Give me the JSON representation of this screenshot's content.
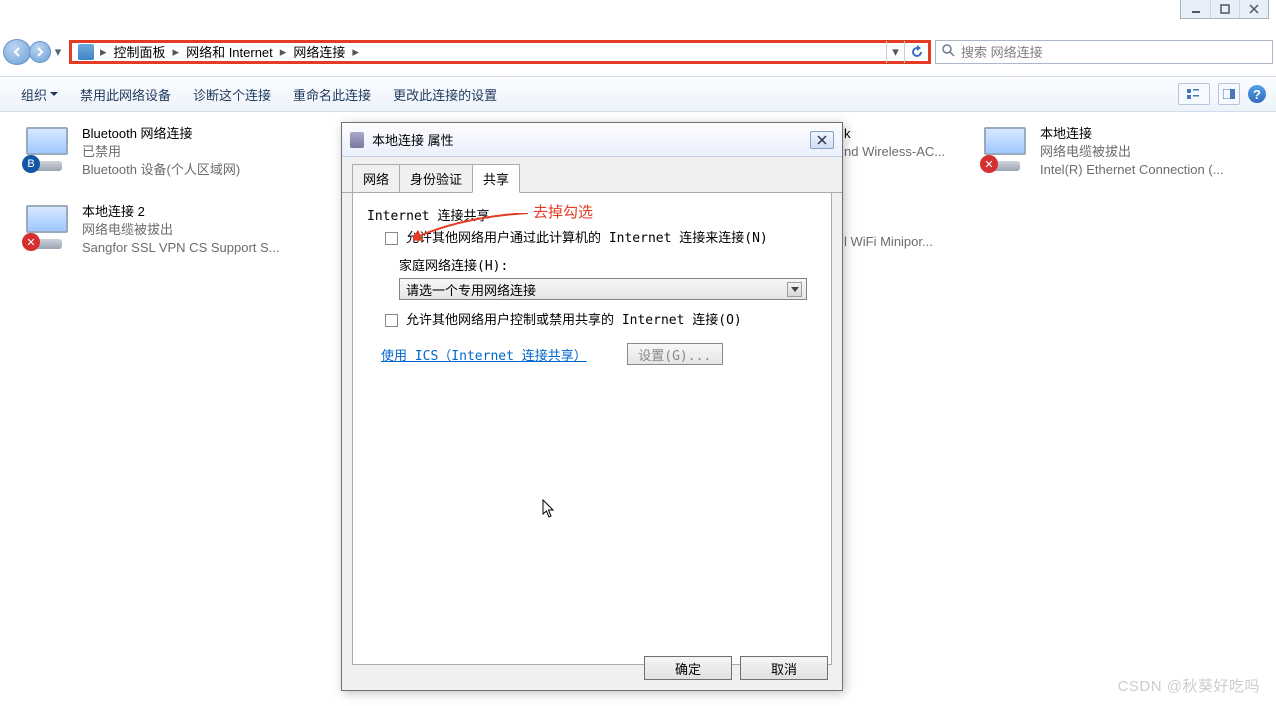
{
  "window_controls": [
    "minimize",
    "maximize",
    "close"
  ],
  "breadcrumb": {
    "items": [
      "控制面板",
      "网络和 Internet",
      "网络连接"
    ]
  },
  "search": {
    "placeholder": "搜索 网络连接"
  },
  "commandbar": {
    "organize": "组织",
    "disable": "禁用此网络设备",
    "diagnose": "诊断这个连接",
    "rename": "重命名此连接",
    "settings": "更改此连接的设置"
  },
  "connections": [
    {
      "title": "Bluetooth 网络连接",
      "status": "已禁用",
      "device": "Bluetooth 设备(个人区域网)",
      "badge": "bt"
    },
    {
      "title": "本地连接 2",
      "status": "网络电缆被拔出",
      "device": "Sangfor SSL VPN CS Support S...",
      "badge": "x"
    },
    {
      "title": "k",
      "status": "",
      "device": "nd Wireless-AC...",
      "badge": ""
    },
    {
      "title": "",
      "status": "",
      "device": "l WiFi Minipor...",
      "badge": ""
    },
    {
      "title": "本地连接",
      "status": "网络电缆被拔出",
      "device": "Intel(R) Ethernet Connection (...",
      "badge": "x"
    }
  ],
  "dialog": {
    "title": "本地连接 属性",
    "tabs": [
      "网络",
      "身份验证",
      "共享"
    ],
    "active_tab": 2,
    "group_title": "Internet 连接共享",
    "annotation": "去掉勾选",
    "opt1": "允许其他网络用户通过此计算机的 Internet 连接来连接(N)",
    "home_label": "家庭网络连接(H):",
    "dropdown": "请选一个专用网络连接",
    "opt2": "允许其他网络用户控制或禁用共享的 Internet 连接(O)",
    "link": "使用 ICS（Internet 连接共享）",
    "settings_btn": "设置(G)...",
    "ok": "确定",
    "cancel": "取消"
  },
  "watermark": "CSDN @秋葵好吃吗"
}
